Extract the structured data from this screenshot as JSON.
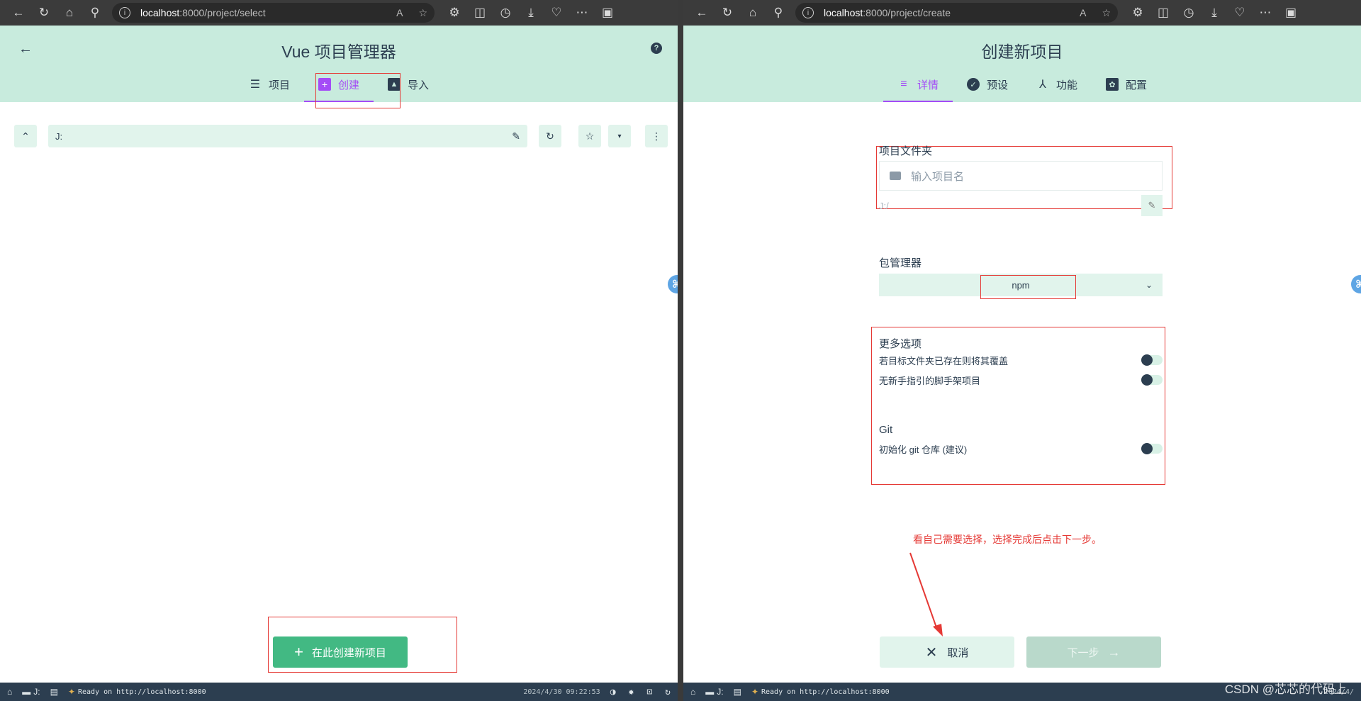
{
  "left": {
    "url_host": "localhost",
    "url_path": ":8000/project/select",
    "app_title": "Vue 项目管理器",
    "tabs": [
      {
        "label": "项目",
        "icon": "list-icon"
      },
      {
        "label": "创建",
        "icon": "add-box-icon"
      },
      {
        "label": "导入",
        "icon": "unarchive-icon"
      }
    ],
    "path_value": "J:",
    "create_button": "在此创建新项目",
    "status": {
      "drive": "J:",
      "ready": "Ready on http://localhost:8000",
      "time": "2024/4/30 09:22:53"
    }
  },
  "right": {
    "url_host": "localhost",
    "url_path": ":8000/project/create",
    "app_title": "创建新项目",
    "tabs": [
      {
        "label": "详情",
        "icon": "subject-icon"
      },
      {
        "label": "预设",
        "icon": "check-circle-icon"
      },
      {
        "label": "功能",
        "icon": "device-hub-icon"
      },
      {
        "label": "配置",
        "icon": "settings-box-icon"
      }
    ],
    "folder_label": "项目文件夹",
    "folder_placeholder": "输入项目名",
    "folder_path": "J:/",
    "pm_label": "包管理器",
    "pm_value": "npm",
    "more_options_title": "更多选项",
    "options": [
      "若目标文件夹已存在则将其覆盖",
      "无新手指引的脚手架项目"
    ],
    "git_title": "Git",
    "git_option": "初始化 git 仓库 (建议)",
    "note": "看自己需要选择，选择完成后点击下一步。",
    "cancel_button": "取消",
    "next_button": "下一步",
    "status": {
      "drive": "J:",
      "ready": "Ready on http://localhost:8000",
      "time": "2024/4/"
    },
    "watermark": "CSDN @芯芯的代码上"
  },
  "colors": {
    "accent": "#a44cf6",
    "header": "#c8ebdd",
    "primary": "#42b983",
    "annotation": "#e53935"
  }
}
